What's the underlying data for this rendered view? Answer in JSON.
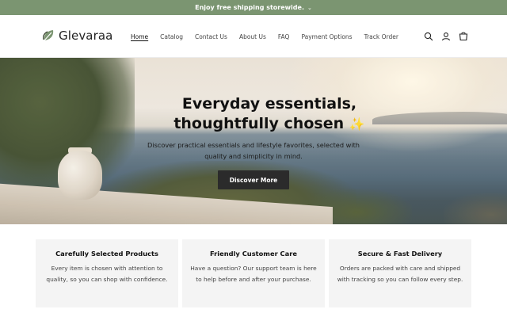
{
  "announcement": {
    "text": "Enjoy free shipping storewide.",
    "chevron": "⌄"
  },
  "header": {
    "brand": "Glevaraa",
    "nav": [
      {
        "label": "Home",
        "active": true
      },
      {
        "label": "Catalog"
      },
      {
        "label": "Contact Us"
      },
      {
        "label": "About Us"
      },
      {
        "label": "FAQ"
      },
      {
        "label": "Payment Options"
      },
      {
        "label": "Track Order"
      }
    ],
    "icons": [
      "search-icon",
      "account-icon",
      "cart-icon"
    ]
  },
  "hero": {
    "title_line1": "Everyday essentials,",
    "title_line2": "thoughtfully chosen",
    "sparkle": "✨",
    "subtitle": "Discover practical essentials and lifestyle favorites, selected with quality and simplicity in mind.",
    "cta": "Discover More"
  },
  "features": [
    {
      "title": "Carefully Selected Products",
      "body": "Every item is chosen with attention to quality, so you can shop with confidence."
    },
    {
      "title": "Friendly Customer Care",
      "body": "Have a question? Our support team is here to help before and after your purchase."
    },
    {
      "title": "Secure & Fast Delivery",
      "body": "Orders are packed with care and shipped with tracking so you can follow every step."
    }
  ],
  "colors": {
    "announcement_bg": "#7b9571",
    "button_bg": "#2b2b2b",
    "card_bg": "#f4f4f4"
  }
}
